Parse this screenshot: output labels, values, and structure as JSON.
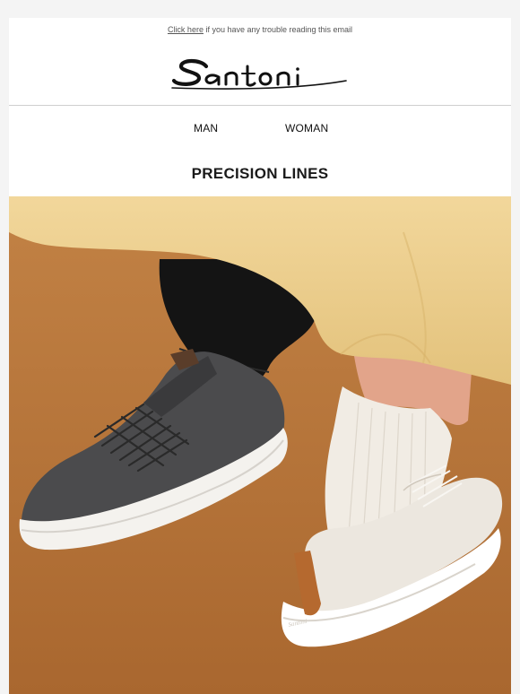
{
  "preheader": {
    "link_text": "Click here",
    "text": " if you have any trouble reading this email"
  },
  "brand": {
    "logo_text": "Santoni"
  },
  "nav": {
    "items": [
      {
        "label": "MAN"
      },
      {
        "label": "WOMAN"
      }
    ]
  },
  "headline": "PRECISION LINES",
  "hero": {
    "alt": "Grey felt lace-up sneaker and white felt sneaker with tan heel tab, worn with socks under a yellow skirt",
    "heel_tab_text": "Santoni"
  },
  "colors": {
    "background": "#f4f4f4",
    "hero_backdrop": "#b8773f",
    "skirt": "#eecf8f",
    "grey_sneaker": "#4a4a4c",
    "white_sneaker": "#ece7df",
    "heel_tab": "#b5692f"
  }
}
